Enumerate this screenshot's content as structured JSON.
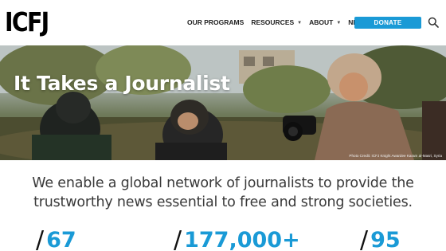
{
  "header": {
    "logo": "ICFJ",
    "nav": [
      {
        "label": "OUR PROGRAMS",
        "has_dropdown": false
      },
      {
        "label": "RESOURCES",
        "has_dropdown": true
      },
      {
        "label": "ABOUT",
        "has_dropdown": true
      },
      {
        "label": "NEWS",
        "has_dropdown": true
      }
    ],
    "donate_label": "DONATE",
    "search_icon": "search-icon",
    "accent_color": "#1a9ad6"
  },
  "hero": {
    "title": "It Takes a Journalist",
    "photo_credit": "Photo Credit: ICFJ Knight Awardee Karam al-Masri, Syria"
  },
  "mission": {
    "line1": "We enable a global network of journalists to provide the",
    "line2": "trustworthy news essential to free and strong societies."
  },
  "stats": [
    {
      "value": "67"
    },
    {
      "value": "177,000+"
    },
    {
      "value": "95"
    }
  ],
  "colors": {
    "accent": "#1a9ad6",
    "text": "#3a3a3a"
  }
}
